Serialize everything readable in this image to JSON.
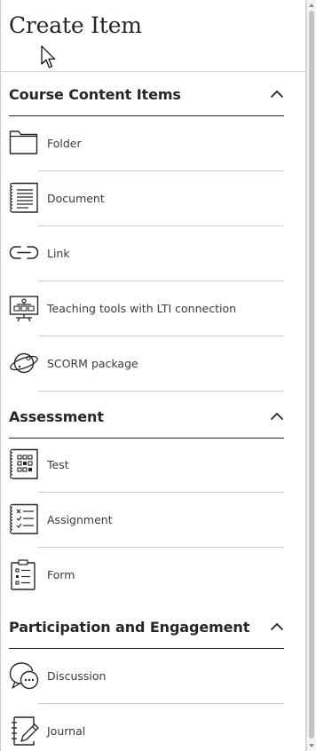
{
  "panel": {
    "title": "Create Item"
  },
  "sections": [
    {
      "title": "Course Content Items",
      "expanded": true,
      "items": [
        {
          "label": "Folder",
          "icon": "folder-icon"
        },
        {
          "label": "Document",
          "icon": "document-icon"
        },
        {
          "label": "Link",
          "icon": "link-icon"
        },
        {
          "label": "Teaching tools with LTI connection",
          "icon": "lti-tool-icon"
        },
        {
          "label": "SCORM package",
          "icon": "scorm-package-icon"
        }
      ]
    },
    {
      "title": "Assessment",
      "expanded": true,
      "items": [
        {
          "label": "Test",
          "icon": "test-icon"
        },
        {
          "label": "Assignment",
          "icon": "assignment-icon"
        },
        {
          "label": "Form",
          "icon": "form-icon"
        }
      ]
    },
    {
      "title": "Participation and Engagement",
      "expanded": true,
      "items": [
        {
          "label": "Discussion",
          "icon": "discussion-icon"
        },
        {
          "label": "Journal",
          "icon": "journal-icon"
        }
      ]
    }
  ],
  "colors": {
    "text": "#262626",
    "label": "#3a3a3a",
    "divider": "#cdcdcd",
    "section_rule": "#262626",
    "background": "#ffffff"
  }
}
